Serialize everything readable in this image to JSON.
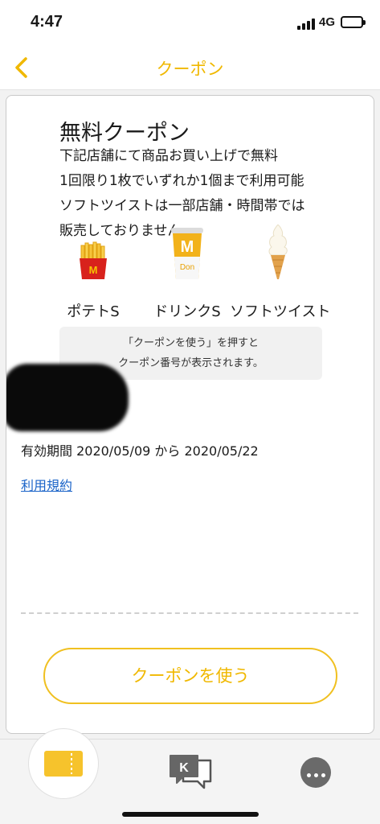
{
  "status": {
    "time": "4:47",
    "network": "4G"
  },
  "nav": {
    "title": "クーポン",
    "back_icon": "chevron-left-icon"
  },
  "coupon": {
    "title": "無料クーポン",
    "description": [
      "下記店舗にて商品お買い上げで無料",
      "1回限り1枚でいずれか1個まで利用可能",
      "ソフトツイストは一部店舗・時間帯では",
      "販売しておりません"
    ],
    "products": [
      {
        "label": "ポテトS",
        "icon": "fries-icon"
      },
      {
        "label": "ドリンクS",
        "icon": "drink-cup-icon"
      },
      {
        "label": "ソフトツイスト",
        "icon": "soft-serve-icon"
      }
    ],
    "notice": [
      "「クーポンを使う」を押すと",
      "クーポン番号が表示されます。"
    ],
    "validity": "有効期間 2020/05/09 から 2020/05/22",
    "terms_link": "利用規約",
    "use_button": "クーポンを使う"
  },
  "tabs": [
    {
      "name": "coupon",
      "icon": "ticket-icon",
      "active": true
    },
    {
      "name": "chat",
      "icon": "chat-icon"
    },
    {
      "name": "more",
      "icon": "more-icon"
    }
  ],
  "colors": {
    "accent": "#f0b800",
    "link": "#1a63c8",
    "battery": "#2fc84a"
  }
}
